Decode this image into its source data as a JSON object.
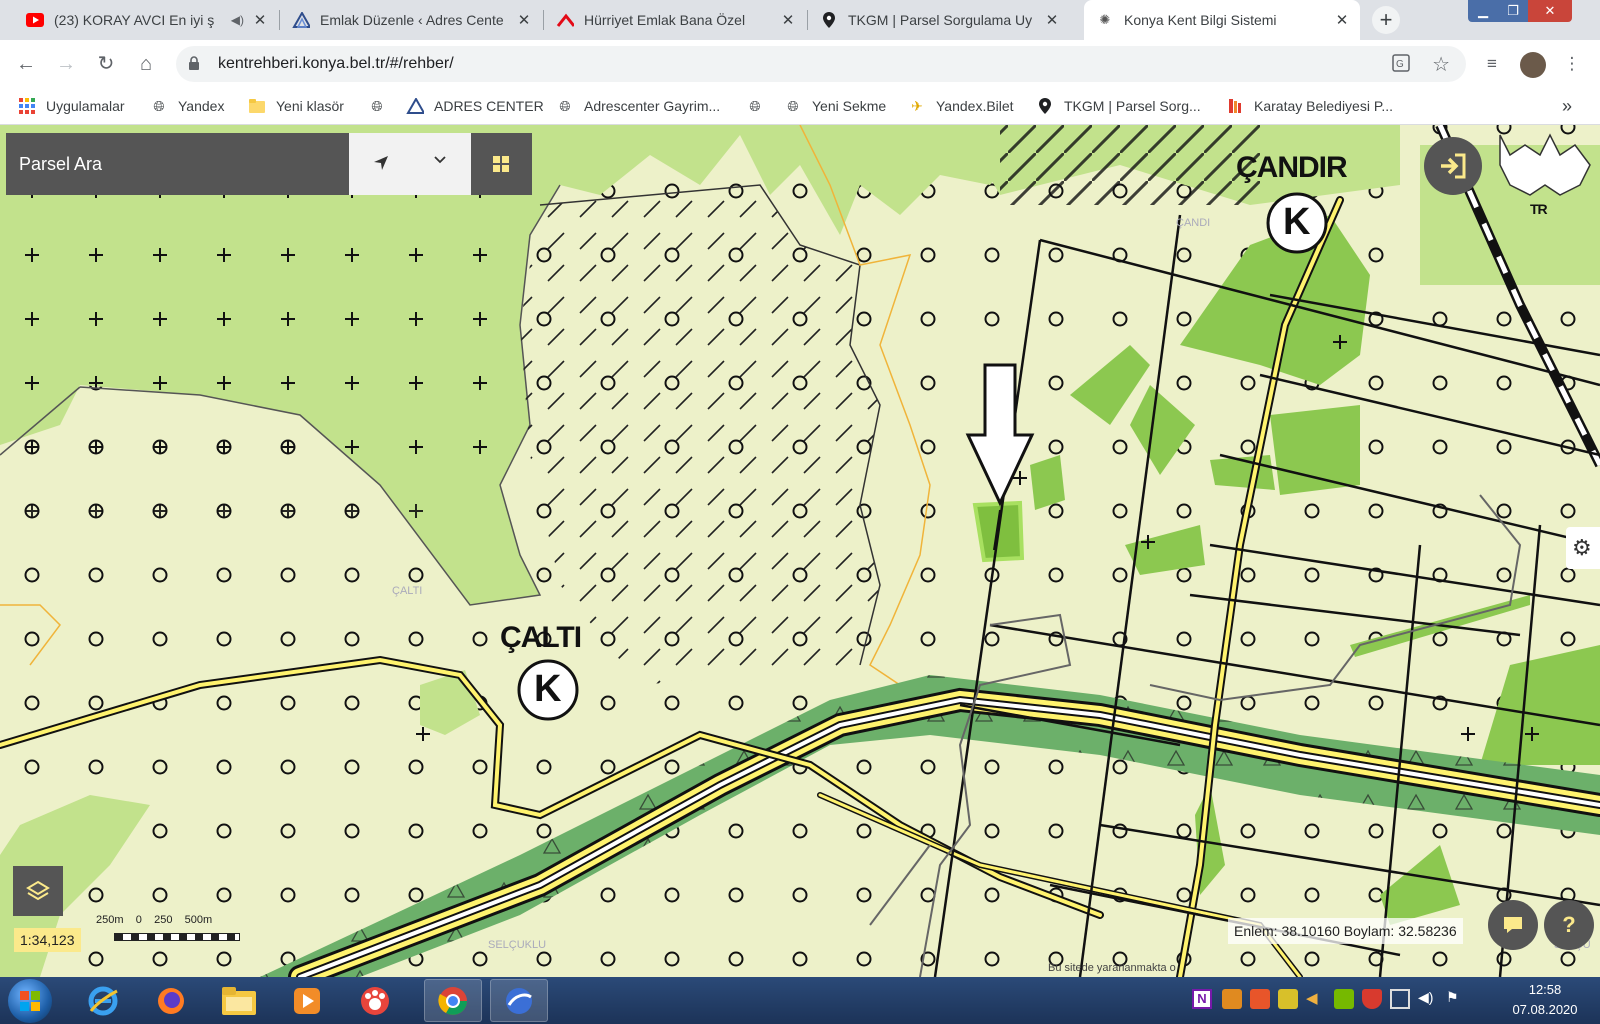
{
  "browser": {
    "tabs": [
      {
        "title": "(23) KORAY AVCI En iyi ş",
        "favicon": "youtube-icon",
        "audio": true,
        "active": false
      },
      {
        "title": "Emlak Düzenle ‹ Adres Cente",
        "favicon": "adres-center-icon",
        "active": false
      },
      {
        "title": "Hürriyet Emlak Bana Özel",
        "favicon": "hurriyet-emlak-icon",
        "active": false
      },
      {
        "title": "TKGM | Parsel Sorgulama Uy",
        "favicon": "location-pin-icon",
        "active": false
      },
      {
        "title": "Konya Kent Bilgi Sistemi",
        "favicon": "konya-logo-icon",
        "active": true
      }
    ],
    "url": "kentrehberi.konya.bel.tr/#/rehber/",
    "bookmarks": [
      {
        "label": "Uygulamalar",
        "icon": "apps-grid-icon"
      },
      {
        "label": "Yandex",
        "icon": "globe-icon"
      },
      {
        "label": "Yeni klasör",
        "icon": "folder-icon"
      },
      {
        "label": "",
        "icon": "globe-icon"
      },
      {
        "label": "ADRES CENTER",
        "icon": "adres-center-icon"
      },
      {
        "label": "Adrescenter Gayrim...",
        "icon": "globe-icon"
      },
      {
        "label": "",
        "icon": "globe-icon"
      },
      {
        "label": "Yeni Sekme",
        "icon": "globe-icon"
      },
      {
        "label": "Yandex.Bilet",
        "icon": "plane-icon"
      },
      {
        "label": "TKGM | Parsel Sorg...",
        "icon": "location-pin-icon"
      },
      {
        "label": "Karatay Belediyesi P...",
        "icon": "karatay-logo-icon"
      }
    ],
    "bookmarks_overflow": "»"
  },
  "map": {
    "search_placeholder": "Parsel Ara",
    "places": {
      "candir": "ÇANDIR",
      "calti": "ÇALTI",
      "calti_small": "ÇALTI",
      "candir_small": "ÇANDI",
      "selcuklu": "SELÇUKLU",
      "selcu": "SELÇU"
    },
    "village_marker": "K",
    "emblem_label": "TR",
    "scale": "1:34,123",
    "scalebar_labels": "250m    0    250    500m",
    "coordinates": "Enlem: 38.10160 Boylam: 32.58236",
    "attribution": "Bu sitede yararlanmakta o",
    "help": "?",
    "colors": {
      "agri_light": "#edf1c9",
      "forest_green": "#c2e28c",
      "park_green": "#8cc850",
      "highway_band": "#6cb06a",
      "road_yellow": "#fff36e",
      "scale_bg": "#fbe98b",
      "panel_gray": "#555555"
    }
  },
  "taskbar": {
    "time": "12:58",
    "date": "07.08.2020",
    "apps": [
      "ie-icon",
      "firefox-icon",
      "explorer-folder-icon",
      "media-player-icon",
      "paw-app-icon",
      "chrome-icon",
      "google-earth-icon"
    ]
  }
}
